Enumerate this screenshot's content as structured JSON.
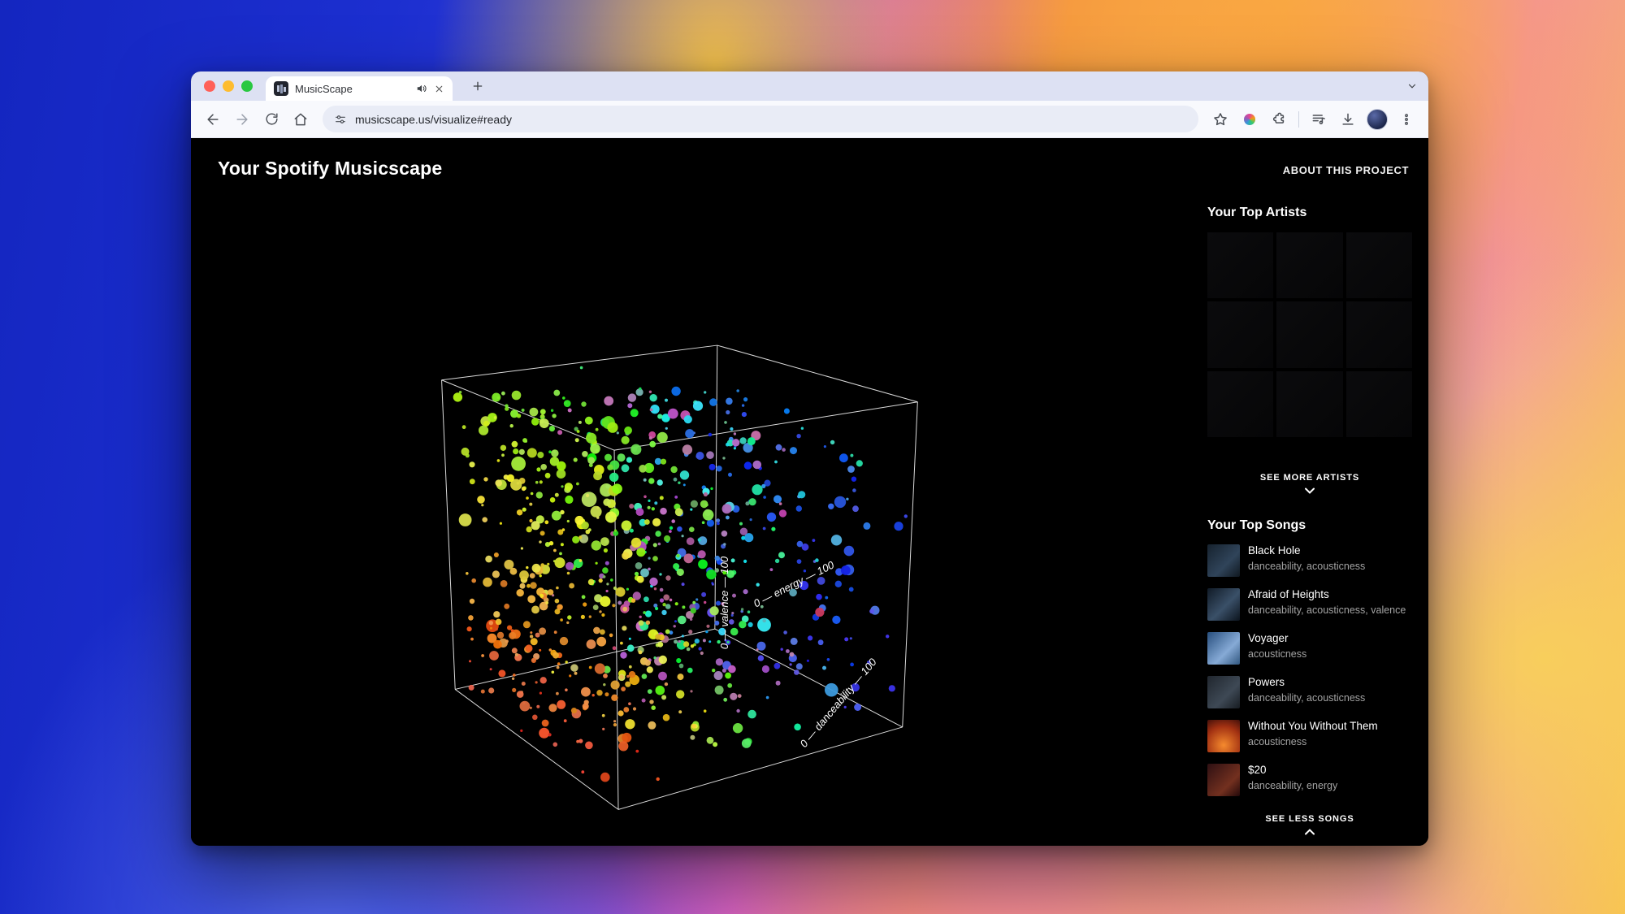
{
  "browser": {
    "tab_title": "MusicScape",
    "url": "musicscape.us/visualize#ready",
    "colors": {
      "traffic_red": "#ff5f57",
      "traffic_yellow": "#febc2e",
      "traffic_green": "#28c840"
    }
  },
  "page": {
    "title": "Your Spotify Musicscape",
    "about_link": "ABOUT THIS PROJECT",
    "sidebar": {
      "artists_heading": "Your Top Artists",
      "see_more_artists": "SEE MORE ARTISTS",
      "songs_heading": "Your Top Songs",
      "see_less_songs": "SEE LESS SONGS",
      "songs": [
        {
          "title": "Black Hole",
          "features": "danceability, acousticness"
        },
        {
          "title": "Afraid of Heights",
          "features": "danceability, acousticness, valence"
        },
        {
          "title": "Voyager",
          "features": "acousticness"
        },
        {
          "title": "Powers",
          "features": "danceability, acousticness"
        },
        {
          "title": "Without You Without Them",
          "features": "acousticness"
        },
        {
          "title": "$20",
          "features": "danceability, energy"
        }
      ]
    },
    "chart_data": {
      "type": "scatter",
      "projection": "3d-cube-wireframe",
      "axes": [
        {
          "label": "valence",
          "min": 0,
          "max": 100
        },
        {
          "label": "energy",
          "min": 0,
          "max": 100
        },
        {
          "label": "danceability",
          "min": 0,
          "max": 100
        }
      ],
      "point_count": 820,
      "color_encoding": "yellow-green top-left, orange-red lower-left, purple-pink center, blue right, teal upper-right"
    }
  }
}
